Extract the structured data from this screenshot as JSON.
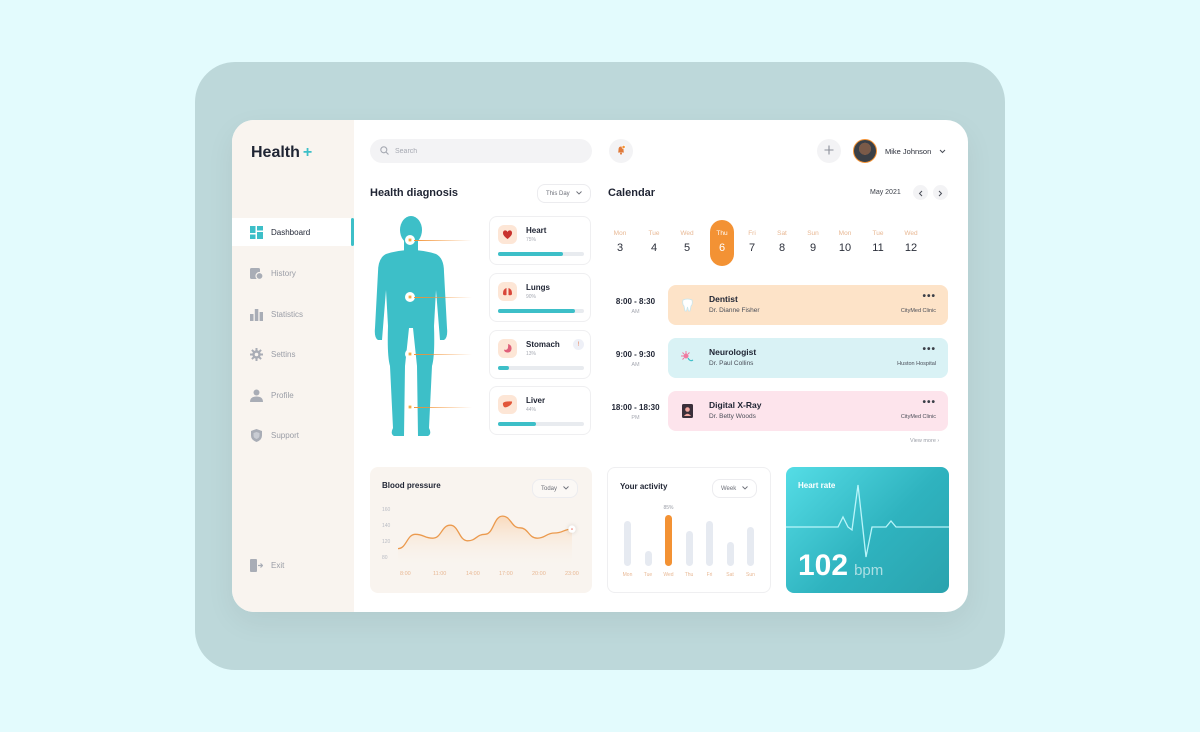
{
  "app": {
    "logo_text": "Health",
    "logo_plus": "+",
    "accent_color": "#3dbfc8",
    "highlight_color": "#f39234"
  },
  "sidebar": {
    "items": [
      {
        "label": "Dashboard",
        "icon": "dashboard-icon",
        "active": true
      },
      {
        "label": "History",
        "icon": "history-icon"
      },
      {
        "label": "Statistics",
        "icon": "statistics-icon"
      },
      {
        "label": "Settins",
        "icon": "gear-icon"
      },
      {
        "label": "Profile",
        "icon": "profile-icon"
      },
      {
        "label": "Support",
        "icon": "shield-icon"
      }
    ],
    "exit_label": "Exit"
  },
  "header": {
    "search_placeholder": "Search",
    "user_name": "Mike Johnson"
  },
  "diagnosis": {
    "title": "Health diagnosis",
    "filter": "This Day",
    "organs": [
      {
        "name": "Heart",
        "percent_label": "75%",
        "value": 75,
        "alert": false
      },
      {
        "name": "Lungs",
        "percent_label": "90%",
        "value": 90,
        "alert": false
      },
      {
        "name": "Stomach",
        "percent_label": "13%",
        "value": 13,
        "alert": true,
        "alert_symbol": "!"
      },
      {
        "name": "Liver",
        "percent_label": "44%",
        "value": 44,
        "alert": false
      }
    ]
  },
  "calendar": {
    "title": "Calendar",
    "month": "May 2021",
    "days": [
      {
        "name": "Mon",
        "date": "3"
      },
      {
        "name": "Tue",
        "date": "4"
      },
      {
        "name": "Wed",
        "date": "5"
      },
      {
        "name": "Thu",
        "date": "6",
        "active": true
      },
      {
        "name": "Fri",
        "date": "7"
      },
      {
        "name": "Sat",
        "date": "8"
      },
      {
        "name": "Sun",
        "date": "9"
      },
      {
        "name": "Mon",
        "date": "10"
      },
      {
        "name": "Tue",
        "date": "11"
      },
      {
        "name": "Wed",
        "date": "12"
      }
    ],
    "appointments": [
      {
        "time": "8:00 - 8:30",
        "ampm": "AM",
        "title": "Dentist",
        "doctor": "Dr. Dianne Fisher",
        "location": "CityMed Clinic",
        "color": "#fde3c8",
        "icon": "tooth-icon"
      },
      {
        "time": "9:00 - 9:30",
        "ampm": "AM",
        "title": "Neurologist",
        "doctor": "Dr. Paul Collins",
        "location": "Huston Hospital",
        "color": "#d9f2f5",
        "icon": "neuron-icon"
      },
      {
        "time": "18:00 - 18:30",
        "ampm": "PM",
        "title": "Digital X-Ray",
        "doctor": "Dr. Betty Woods",
        "location": "CityMed Clinic",
        "color": "#fde4ec",
        "icon": "xray-icon"
      }
    ],
    "more_label": "•••",
    "view_more": "View more"
  },
  "blood_pressure": {
    "title": "Blood pressure",
    "filter": "Today",
    "y_labels": [
      "160",
      "140",
      "120",
      "80"
    ],
    "x_labels": [
      "8:00",
      "11:00",
      "14:00",
      "17:00",
      "20:00",
      "23:00"
    ]
  },
  "activity": {
    "title": "Your activity",
    "filter": "Week",
    "highlight_label": "85%",
    "days": [
      "Mon",
      "Tue",
      "Wed",
      "Thu",
      "Fri",
      "Sat",
      "Sun"
    ]
  },
  "heart_rate": {
    "title": "Heart rate",
    "value": "102",
    "unit": "bpm"
  },
  "chart_data": [
    {
      "type": "line",
      "title": "Blood pressure",
      "x": [
        "8:00",
        "9:30",
        "11:00",
        "12:30",
        "14:00",
        "15:30",
        "17:00",
        "18:30",
        "20:00",
        "21:30",
        "23:00"
      ],
      "y": [
        96,
        118,
        112,
        132,
        108,
        118,
        146,
        128,
        112,
        120,
        126
      ],
      "y_tick_labels": [
        "160",
        "140",
        "120",
        "80"
      ],
      "ylim": [
        80,
        160
      ],
      "grid": false
    },
    {
      "type": "bar",
      "title": "Your activity",
      "categories": [
        "Mon",
        "Tue",
        "Wed",
        "Thu",
        "Fri",
        "Sat",
        "Sun"
      ],
      "values": [
        75,
        25,
        85,
        58,
        75,
        40,
        65
      ],
      "ylim": [
        0,
        100
      ],
      "annotations": [
        {
          "category": "Wed",
          "text": "85%"
        }
      ]
    }
  ]
}
